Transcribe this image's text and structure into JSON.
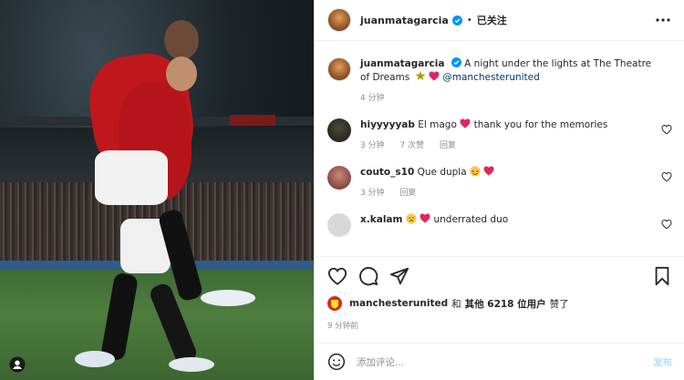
{
  "post_header": {
    "username": "juanmatagarcia",
    "separator": "•",
    "follow_label": "已关注"
  },
  "caption": {
    "username": "juanmatagarcia",
    "text": "A night under the lights at The Theatre of Dreams",
    "mention": "@manchesterunited",
    "time": "4 分钟"
  },
  "comments": [
    {
      "username": "hiyyyyyab",
      "text": "El mago",
      "text2": "thank you for the memories",
      "time": "3 分钟",
      "likes": "7 次赞",
      "reply": "回复"
    },
    {
      "username": "couto_s10",
      "text": "Que dupla",
      "time": "3 分钟",
      "reply": "回复"
    },
    {
      "username": "x.kalam",
      "text": "underrated duo"
    }
  ],
  "likes": {
    "user": "manchesterunited",
    "conj": "和",
    "others": "其他 6218 位用户",
    "suffix": "赞了"
  },
  "posted_ago": "9 分钟前",
  "comment_box": {
    "placeholder": "添加评论...",
    "post_label": "发布"
  },
  "colors": {
    "verified_blue": "#0095f6",
    "heart_red": "#ed4956",
    "post_disabled": "#b2dffc",
    "mu_red": "#da291c"
  }
}
